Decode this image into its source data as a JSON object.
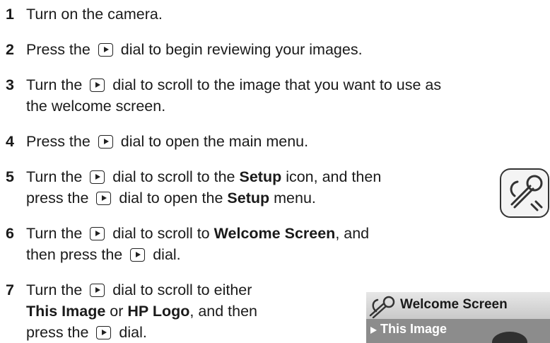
{
  "steps": [
    {
      "num": "1",
      "lines": [
        [
          {
            "t": "Turn on the camera."
          }
        ]
      ]
    },
    {
      "num": "2",
      "lines": [
        [
          {
            "t": "Press the "
          },
          {
            "icon": "playback-icon"
          },
          {
            "t": " dial to begin reviewing your images."
          }
        ]
      ]
    },
    {
      "num": "3",
      "lines": [
        [
          {
            "t": "Turn the "
          },
          {
            "icon": "playback-icon"
          },
          {
            "t": " dial to scroll to the image that you want to use as"
          }
        ],
        [
          {
            "t": "the welcome screen."
          }
        ]
      ]
    },
    {
      "num": "4",
      "lines": [
        [
          {
            "t": "Press the "
          },
          {
            "icon": "playback-icon"
          },
          {
            "t": " dial to open the main menu."
          }
        ]
      ]
    },
    {
      "num": "5",
      "lines": [
        [
          {
            "t": "Turn the "
          },
          {
            "icon": "playback-icon"
          },
          {
            "t": " dial to scroll to the "
          },
          {
            "t": "Setup",
            "b": true
          },
          {
            "t": " icon, and then"
          }
        ],
        [
          {
            "t": "press the "
          },
          {
            "icon": "playback-icon"
          },
          {
            "t": " dial to open the "
          },
          {
            "t": "Setup",
            "b": true
          },
          {
            "t": " menu."
          }
        ]
      ]
    },
    {
      "num": "6",
      "lines": [
        [
          {
            "t": "Turn the "
          },
          {
            "icon": "playback-icon"
          },
          {
            "t": " dial to scroll to "
          },
          {
            "t": "Welcome Screen",
            "b": true
          },
          {
            "t": ", and"
          }
        ],
        [
          {
            "t": "then press the "
          },
          {
            "icon": "playback-icon"
          },
          {
            "t": " dial."
          }
        ]
      ]
    },
    {
      "num": "7",
      "lines": [
        [
          {
            "t": "Turn the "
          },
          {
            "icon": "playback-icon"
          },
          {
            "t": " dial to scroll to either"
          }
        ],
        [
          {
            "t": "This Image",
            "b": true
          },
          {
            "t": " or "
          },
          {
            "t": "HP Logo",
            "b": true
          },
          {
            "t": ", and then"
          }
        ],
        [
          {
            "t": "press the "
          },
          {
            "icon": "playback-icon"
          },
          {
            "t": " dial."
          }
        ]
      ]
    }
  ],
  "setup_icon": {
    "icon": "wrench-icon"
  },
  "welcome_panel": {
    "title": "Welcome Screen",
    "selected_item": "This Image",
    "title_icon": "wrench-icon",
    "selected_marker": "triangle-right-icon"
  }
}
